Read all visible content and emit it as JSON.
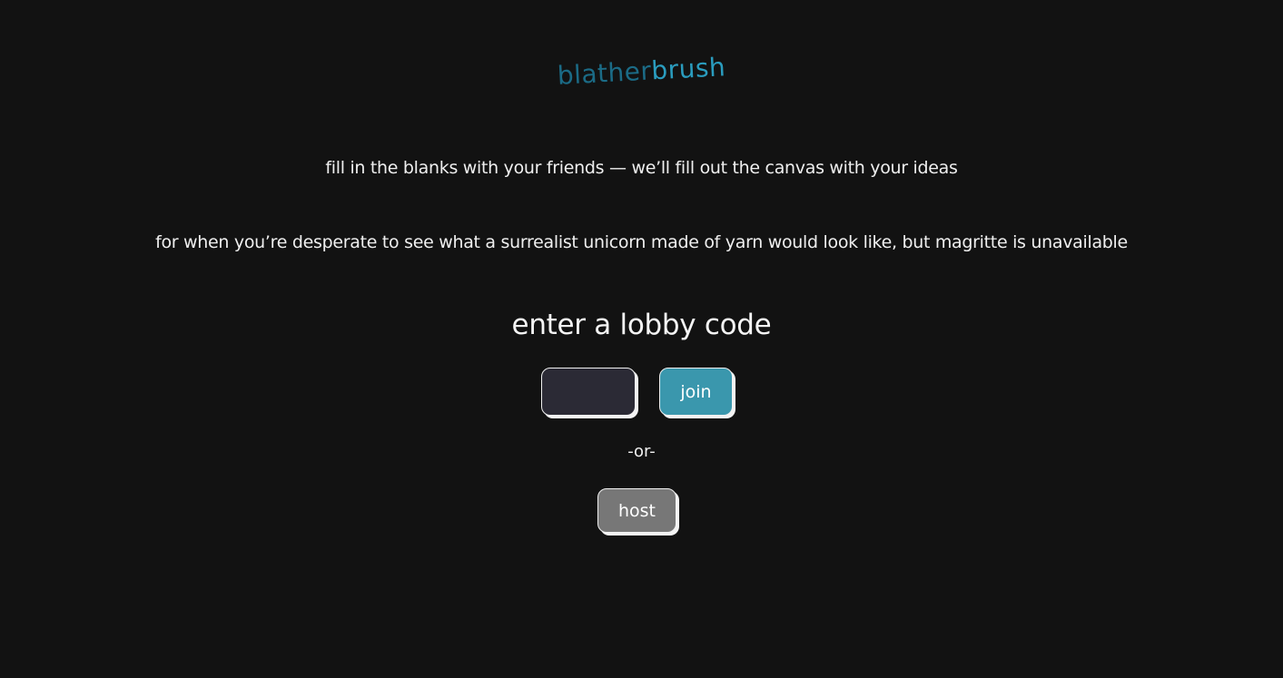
{
  "logo": {
    "text_part1": "blather",
    "text_part2": "brush",
    "color1": "#1b6b86",
    "color2": "#2a9cbe"
  },
  "tagline": "fill in the blanks with your friends — we’ll fill out the canvas with your ideas",
  "subtagline": "for when you’re desperate to see what a surrealist unicorn made of yarn would look like, but magritte is unavailable",
  "lobby": {
    "heading": "enter a lobby code",
    "code_value": "",
    "code_placeholder": "",
    "join_label": "join",
    "separator": "-or-",
    "host_label": "host"
  },
  "colors": {
    "background": "#121212",
    "join_button": "#3a97ad",
    "host_button": "#777777",
    "input_bg": "#2b2a35"
  }
}
